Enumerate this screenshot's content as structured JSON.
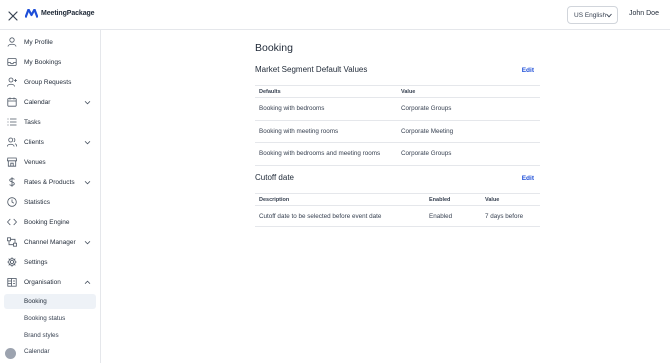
{
  "brand": {
    "name": "MeetingPackage",
    "accent": "#1d4ed8"
  },
  "header": {
    "close_icon": "close-icon",
    "language": "US English",
    "user": "John Doe"
  },
  "sidebar": {
    "items": [
      {
        "label": "My Profile",
        "icon": "user-icon"
      },
      {
        "label": "My Bookings",
        "icon": "inbox-icon"
      },
      {
        "label": "Group Requests",
        "icon": "user-plus-icon"
      },
      {
        "label": "Calendar",
        "icon": "calendar-icon",
        "expandable": true
      },
      {
        "label": "Tasks",
        "icon": "list-icon"
      },
      {
        "label": "Clients",
        "icon": "users-icon",
        "expandable": true
      },
      {
        "label": "Venues",
        "icon": "store-icon"
      },
      {
        "label": "Rates & Products",
        "icon": "dollar-icon",
        "expandable": true
      },
      {
        "label": "Statistics",
        "icon": "clock-icon"
      },
      {
        "label": "Booking Engine",
        "icon": "code-icon"
      },
      {
        "label": "Channel Manager",
        "icon": "share-icon",
        "expandable": true
      },
      {
        "label": "Settings",
        "icon": "gear-icon"
      },
      {
        "label": "Organisation",
        "icon": "building-icon",
        "expandable": true,
        "expanded": true
      }
    ],
    "sub_items": [
      {
        "label": "Booking",
        "active": true
      },
      {
        "label": "Booking status"
      },
      {
        "label": "Brand styles"
      },
      {
        "label": "Calendar"
      }
    ]
  },
  "main": {
    "title": "Booking",
    "market_segment": {
      "title": "Market Segment Default Values",
      "edit_label": "Edit",
      "columns": [
        "Defaults",
        "Value"
      ],
      "rows": [
        [
          "Booking with bedrooms",
          "Corporate Groups"
        ],
        [
          "Booking with meeting rooms",
          "Corporate Meeting"
        ],
        [
          "Booking with bedrooms and meeting rooms",
          "Corporate Groups"
        ]
      ]
    },
    "cutoff": {
      "title": "Cutoff date",
      "edit_label": "Edit",
      "columns": [
        "Description",
        "Enabled",
        "Value"
      ],
      "rows": [
        [
          "Cutoff date to be selected before event date",
          "Enabled",
          "7 days before"
        ]
      ]
    }
  }
}
